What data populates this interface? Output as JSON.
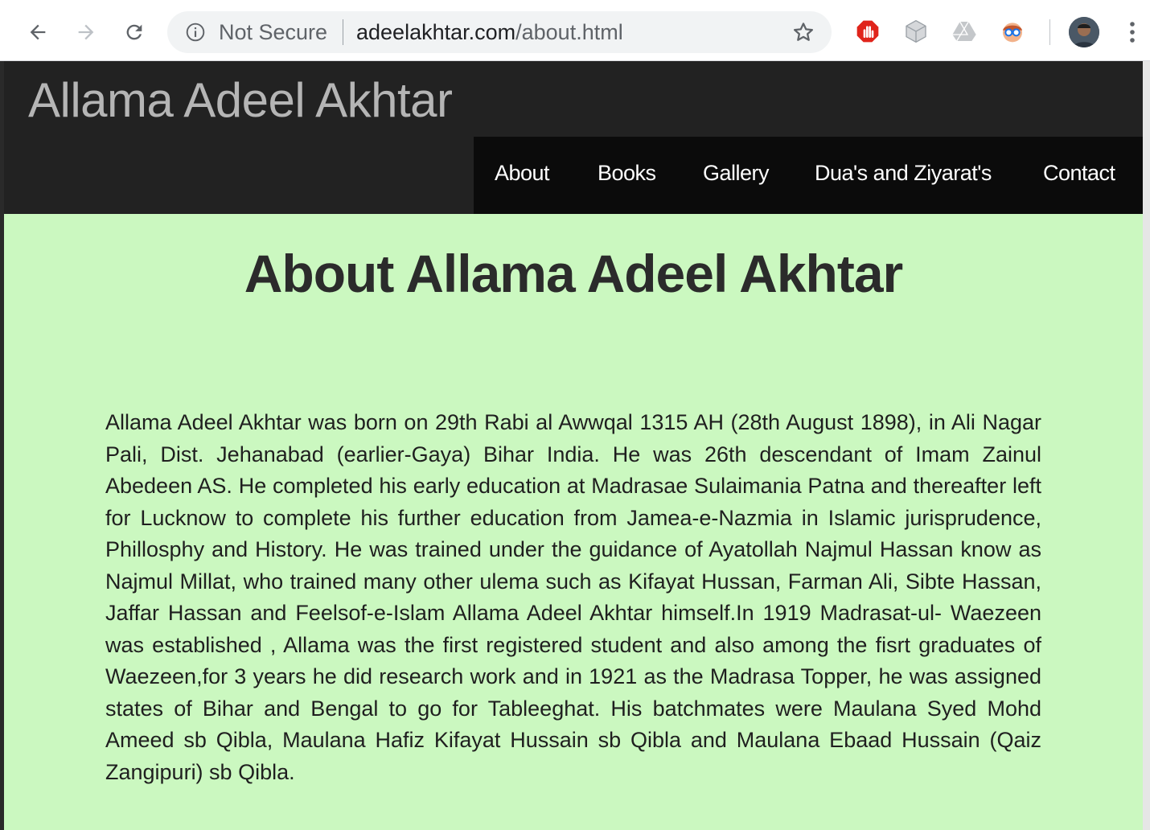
{
  "browser": {
    "security_label": "Not Secure",
    "url_host": "adeelakhtar.com",
    "url_path": "/about.html",
    "icons": [
      "back-arrow-icon",
      "forward-arrow-icon",
      "reload-icon",
      "info-icon",
      "star-icon",
      "adblock-icon",
      "extension-cube-icon",
      "drive-icon",
      "extension-face-icon",
      "menu-icon"
    ]
  },
  "site": {
    "title": "Allama Adeel Akhtar",
    "nav": [
      "About",
      "Books",
      "Gallery",
      "Dua's and Ziyarat's",
      "Contact"
    ]
  },
  "main": {
    "heading": "About Allama Adeel Akhtar",
    "paragraph": "Allama Adeel Akhtar was born on 29th Rabi al Awwqal 1315 AH (28th August 1898), in Ali Nagar Pali, Dist. Jehanabad (earlier-Gaya) Bihar India. He was 26th descendant of Imam Zainul Abedeen AS. He completed his early education at Madrasae Sulaimania Patna and thereafter left for Lucknow to complete his further education from Jamea-e-Nazmia in Islamic jurisprudence, Phillosphy and History. He was trained under the guidance of Ayatollah Najmul Hassan know as Najmul Millat, who trained many other ulema such as Kifayat Hussan, Farman Ali, Sibte Hassan, Jaffar Hassan and Feelsof-e-Islam Allama Adeel Akhtar himself.In 1919 Madrasat-ul- Waezeen was established , Allama was the first registered student and also among the fisrt graduates of Waezeen,for 3 years he did research work and in 1921 as the Madrasa Topper, he was assigned states of Bihar and Bengal to go for Tableeghat. His batchmates were Maulana Syed Mohd Ameed sb Qibla, Maulana Hafiz Kifayat Hussain sb Qibla and Maulana Ebaad Hussain (Qaiz Zangipuri) sb Qibla."
  },
  "colors": {
    "header_bg": "#222222",
    "navbar_bg": "#0b0b0b",
    "page_bg": "#cbf8c0",
    "site_title": "#b5b5b5"
  }
}
